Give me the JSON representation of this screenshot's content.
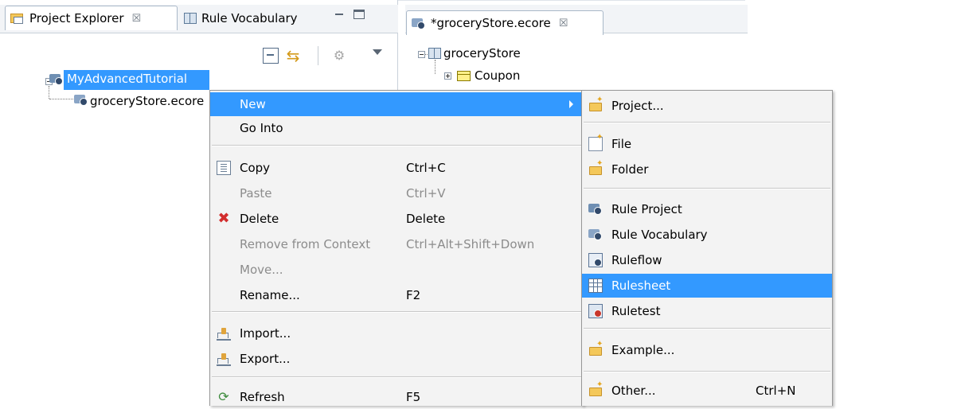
{
  "project_explorer": {
    "tabs": [
      {
        "label": "Project Explorer",
        "icon": "project-explorer-icon",
        "close": "☒"
      },
      {
        "label": "Rule Vocabulary",
        "icon": "book-icon"
      }
    ],
    "toolbar": {
      "link_glyph": "⇆",
      "filter_glyph": "⚙"
    },
    "tree": [
      {
        "label": "MyAdvancedTutorial",
        "selected": true,
        "icon": "rule-project-icon"
      },
      {
        "label": "groceryStore.ecore",
        "icon": "vocabulary-file-icon"
      }
    ]
  },
  "editor": {
    "tab": {
      "label": "*groceryStore.ecore",
      "close": "☒"
    },
    "tree": [
      {
        "label": "groceryStore",
        "icon": "package-icon"
      },
      {
        "label": "Coupon",
        "icon": "class-icon"
      }
    ]
  },
  "context_menu": {
    "items": [
      {
        "label": "New",
        "highlighted": true,
        "submenu": true
      },
      {
        "label": "Go Into"
      },
      {
        "label": "Copy",
        "shortcut": "Ctrl+C",
        "icon": "copy-icon"
      },
      {
        "label": "Paste",
        "shortcut": "Ctrl+V",
        "disabled": true
      },
      {
        "label": "Delete",
        "shortcut": "Delete",
        "icon": "delete-icon"
      },
      {
        "label": "Remove from Context",
        "shortcut": "Ctrl+Alt+Shift+Down",
        "disabled": true
      },
      {
        "label": "Move...",
        "disabled": true
      },
      {
        "label": "Rename...",
        "shortcut": "F2"
      },
      {
        "label": "Import...",
        "icon": "import-icon"
      },
      {
        "label": "Export...",
        "icon": "export-icon"
      },
      {
        "label": "Refresh",
        "shortcut": "F5",
        "icon": "refresh-icon"
      }
    ]
  },
  "submenu": {
    "items": [
      {
        "label": "Project...",
        "icon": "new-project-icon"
      },
      {
        "label": "File",
        "icon": "new-file-icon"
      },
      {
        "label": "Folder",
        "icon": "new-folder-icon"
      },
      {
        "label": "Rule Project",
        "icon": "rule-project-icon"
      },
      {
        "label": "Rule Vocabulary",
        "icon": "rule-vocabulary-icon"
      },
      {
        "label": "Ruleflow",
        "icon": "ruleflow-icon"
      },
      {
        "label": "Rulesheet",
        "icon": "rulesheet-icon",
        "highlighted": true
      },
      {
        "label": "Ruletest",
        "icon": "ruletest-icon"
      },
      {
        "label": "Example...",
        "icon": "example-icon"
      },
      {
        "label": "Other...",
        "shortcut": "Ctrl+N",
        "icon": "other-icon"
      }
    ]
  },
  "colors": {
    "selection": "#3399ff",
    "menu_bg": "#f3f3f3",
    "disabled_text": "#8c8c8c"
  }
}
